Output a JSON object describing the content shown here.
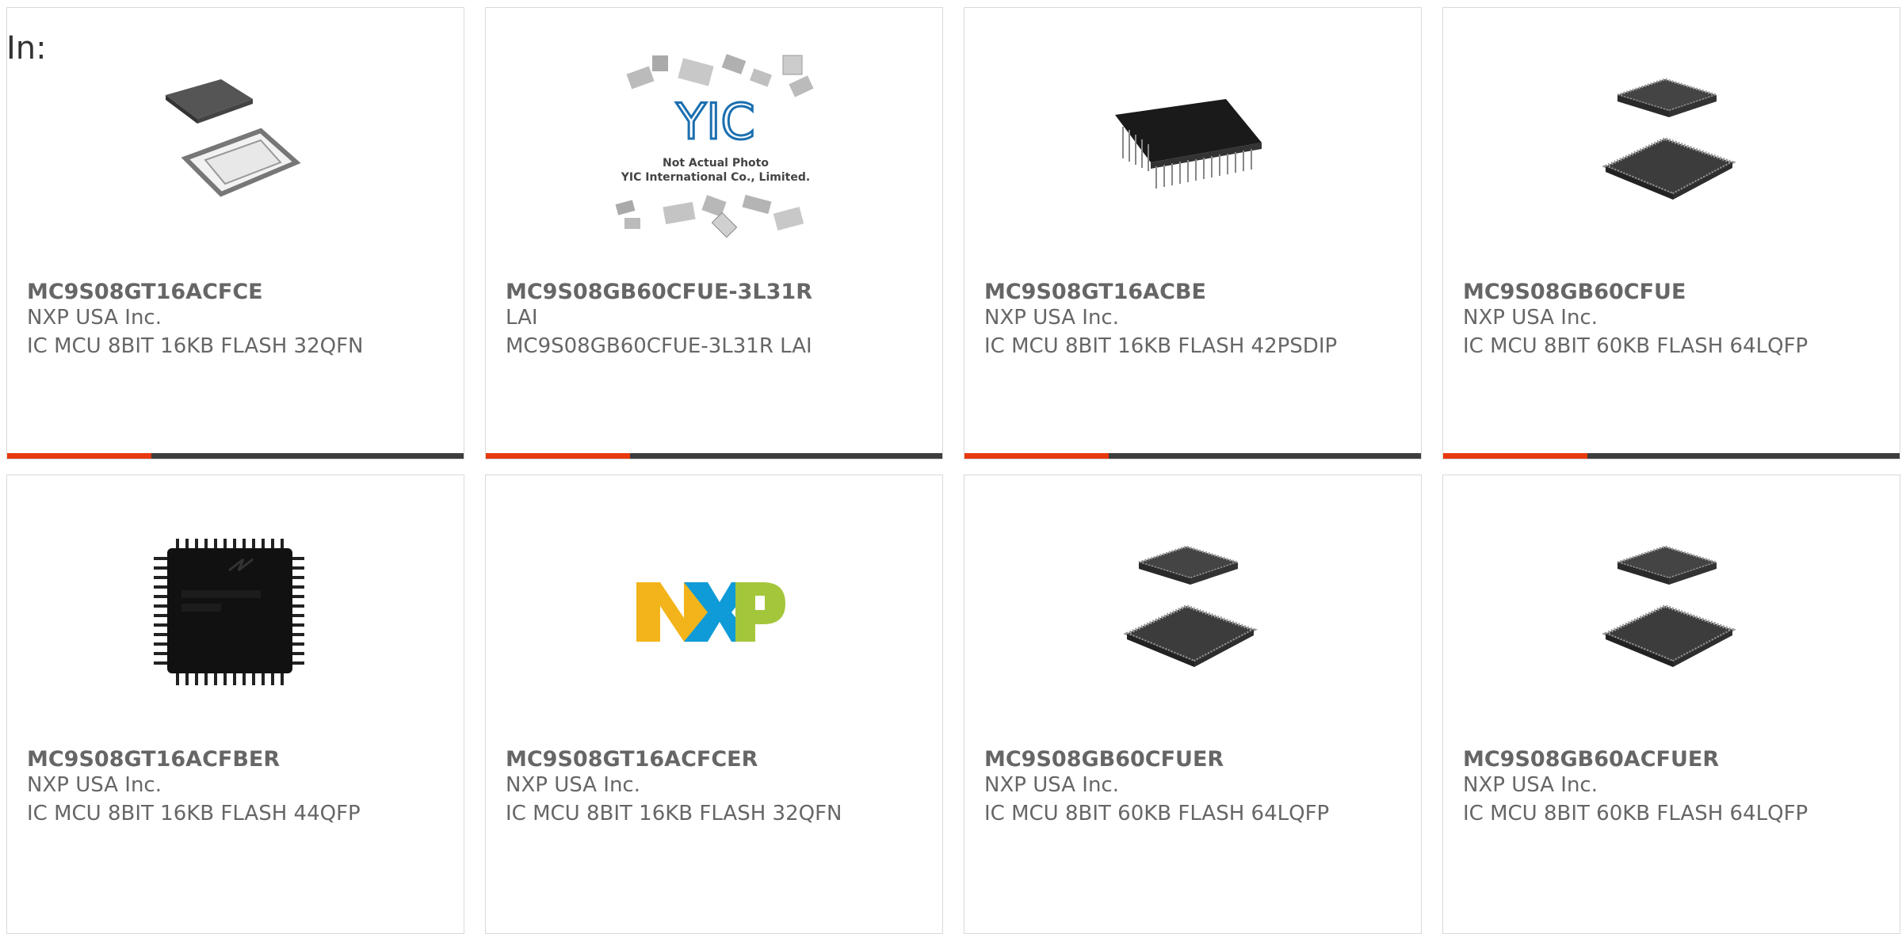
{
  "filter_label": "In:",
  "colors": {
    "accent": "#e8380d",
    "bar": "#3d3d3d",
    "text": "#666666",
    "border": "#d9d9d9"
  },
  "products": [
    {
      "part": "MC9S08GT16ACFCE",
      "manufacturer": "NXP USA Inc.",
      "description": "IC MCU 8BIT 16KB FLASH 32QFN",
      "image": "qfn-chip-icon"
    },
    {
      "part": "MC9S08GB60CFUE-3L31R",
      "manufacturer": "LAI",
      "description": "MC9S08GB60CFUE-3L31R LAI",
      "image": "yic-placeholder-icon",
      "placeholder": {
        "logo": "YIC",
        "line1": "Not Actual Photo",
        "line2": "YIC International Co., Limited."
      }
    },
    {
      "part": "MC9S08GT16ACBE",
      "manufacturer": "NXP USA Inc.",
      "description": "IC MCU 8BIT 16KB FLASH 42PSDIP",
      "image": "dip-chip-icon"
    },
    {
      "part": "MC9S08GB60CFUE",
      "manufacturer": "NXP USA Inc.",
      "description": "IC MCU 8BIT 60KB FLASH 64LQFP",
      "image": "lqfp-chip-icon"
    },
    {
      "part": "MC9S08GT16ACFBER",
      "manufacturer": "NXP USA Inc.",
      "description": "IC MCU 8BIT 16KB FLASH 44QFP",
      "image": "qfp-chip-icon"
    },
    {
      "part": "MC9S08GT16ACFCER",
      "manufacturer": "NXP USA Inc.",
      "description": "IC MCU 8BIT 16KB FLASH 32QFN",
      "image": "nxp-logo-icon",
      "logo_text": "NXP"
    },
    {
      "part": "MC9S08GB60CFUER",
      "manufacturer": "NXP USA Inc.",
      "description": "IC MCU 8BIT 60KB FLASH 64LQFP",
      "image": "lqfp-chip-icon"
    },
    {
      "part": "MC9S08GB60ACFUER",
      "manufacturer": "NXP USA Inc.",
      "description": "IC MCU 8BIT 60KB FLASH 64LQFP",
      "image": "lqfp-chip-icon"
    }
  ]
}
